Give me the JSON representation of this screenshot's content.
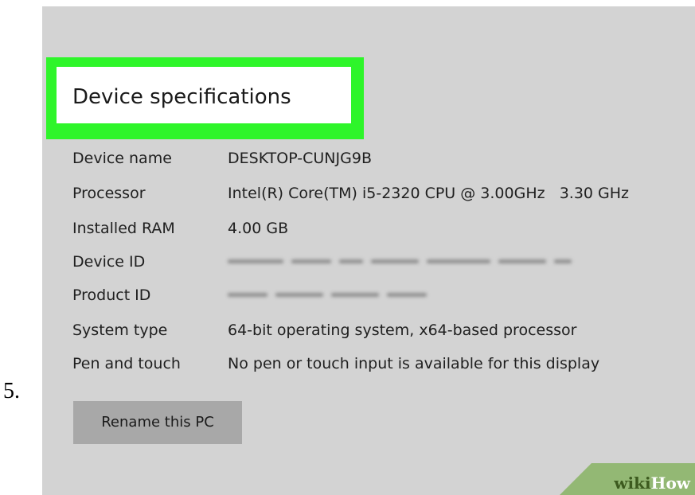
{
  "step": {
    "number": "5."
  },
  "section": {
    "title": "Device specifications"
  },
  "specs": [
    {
      "label": "Device name",
      "value": "DESKTOP-CUNJG9B",
      "redacted": false
    },
    {
      "label": "Processor",
      "value": "Intel(R) Core(TM) i5-2320 CPU @ 3.00GHz   3.30 GHz",
      "redacted": false
    },
    {
      "label": "Installed RAM",
      "value": "4.00 GB",
      "redacted": false
    },
    {
      "label": "Device ID",
      "value": "",
      "redacted": true
    },
    {
      "label": "Product ID",
      "value": "",
      "redacted": true
    },
    {
      "label": "System type",
      "value": "64-bit operating system, x64-based processor",
      "redacted": false
    },
    {
      "label": "Pen and touch",
      "value": "No pen or touch input is available for this display",
      "redacted": false
    }
  ],
  "actions": {
    "rename_label": "Rename this PC"
  },
  "watermark": {
    "part1": "wiki",
    "part2": "How"
  },
  "colors": {
    "panel_background": "#d3d3d3",
    "highlight": "#2ef52a",
    "button": "#a8a8a8",
    "watermark_green": "#93b874"
  }
}
